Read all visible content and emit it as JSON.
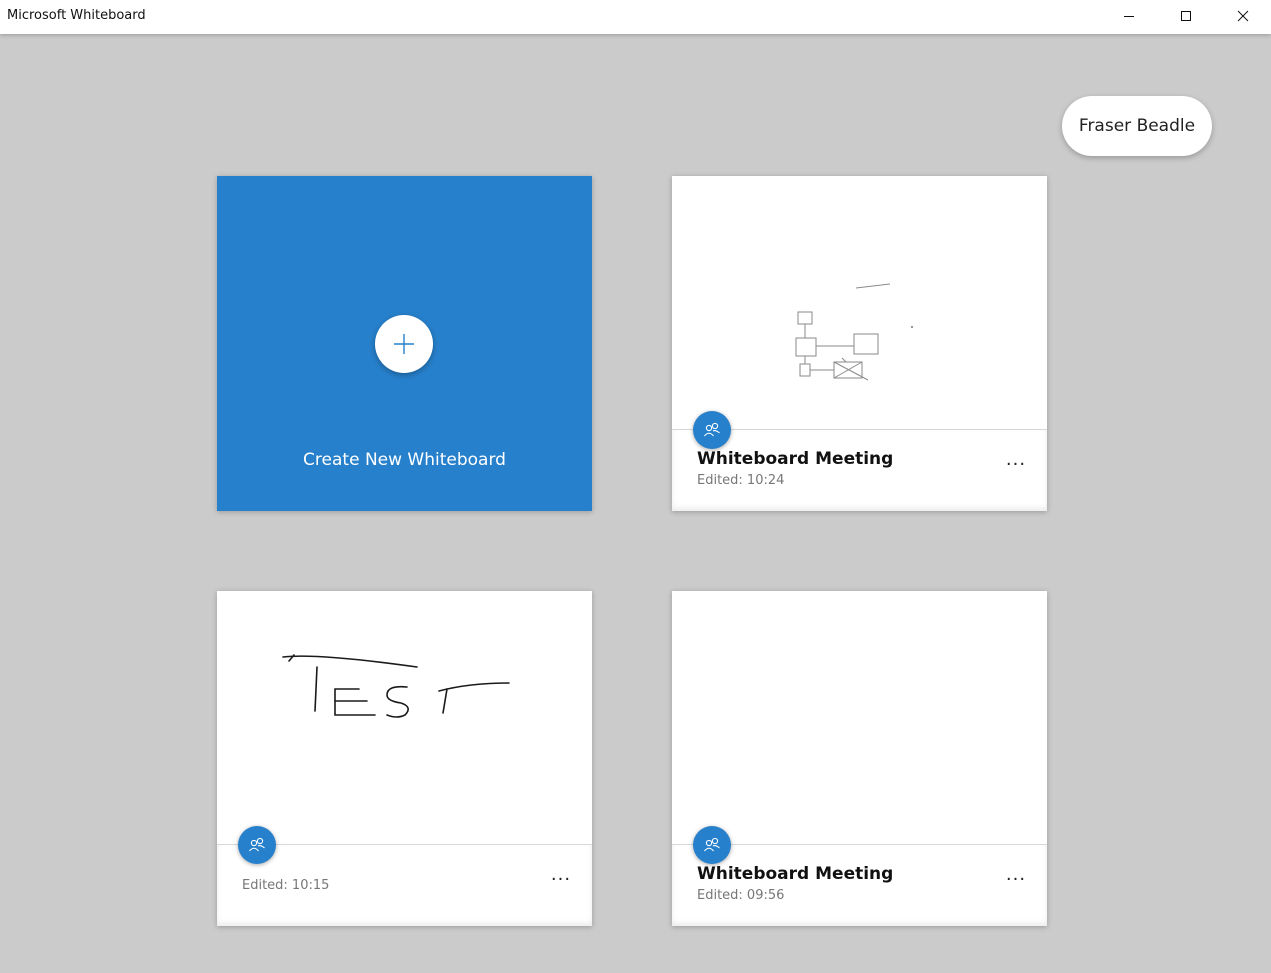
{
  "window": {
    "title": "Microsoft Whiteboard"
  },
  "user": {
    "name": "Fraser Beadle"
  },
  "create_card": {
    "label": "Create New Whiteboard",
    "color": "#2780cb"
  },
  "boards": [
    {
      "name": "Whiteboard Meeting",
      "edited": "Edited: 10:24",
      "shared_icon": "people-icon"
    },
    {
      "name": "",
      "edited": "Edited: 10:15",
      "shared_icon": "people-icon",
      "preview_text": "TEST"
    },
    {
      "name": "Whiteboard Meeting",
      "edited": "Edited: 09:56",
      "shared_icon": "people-icon"
    }
  ],
  "more_label": "···",
  "colors": {
    "accent": "#2780cb",
    "background": "#cbcbcb"
  }
}
